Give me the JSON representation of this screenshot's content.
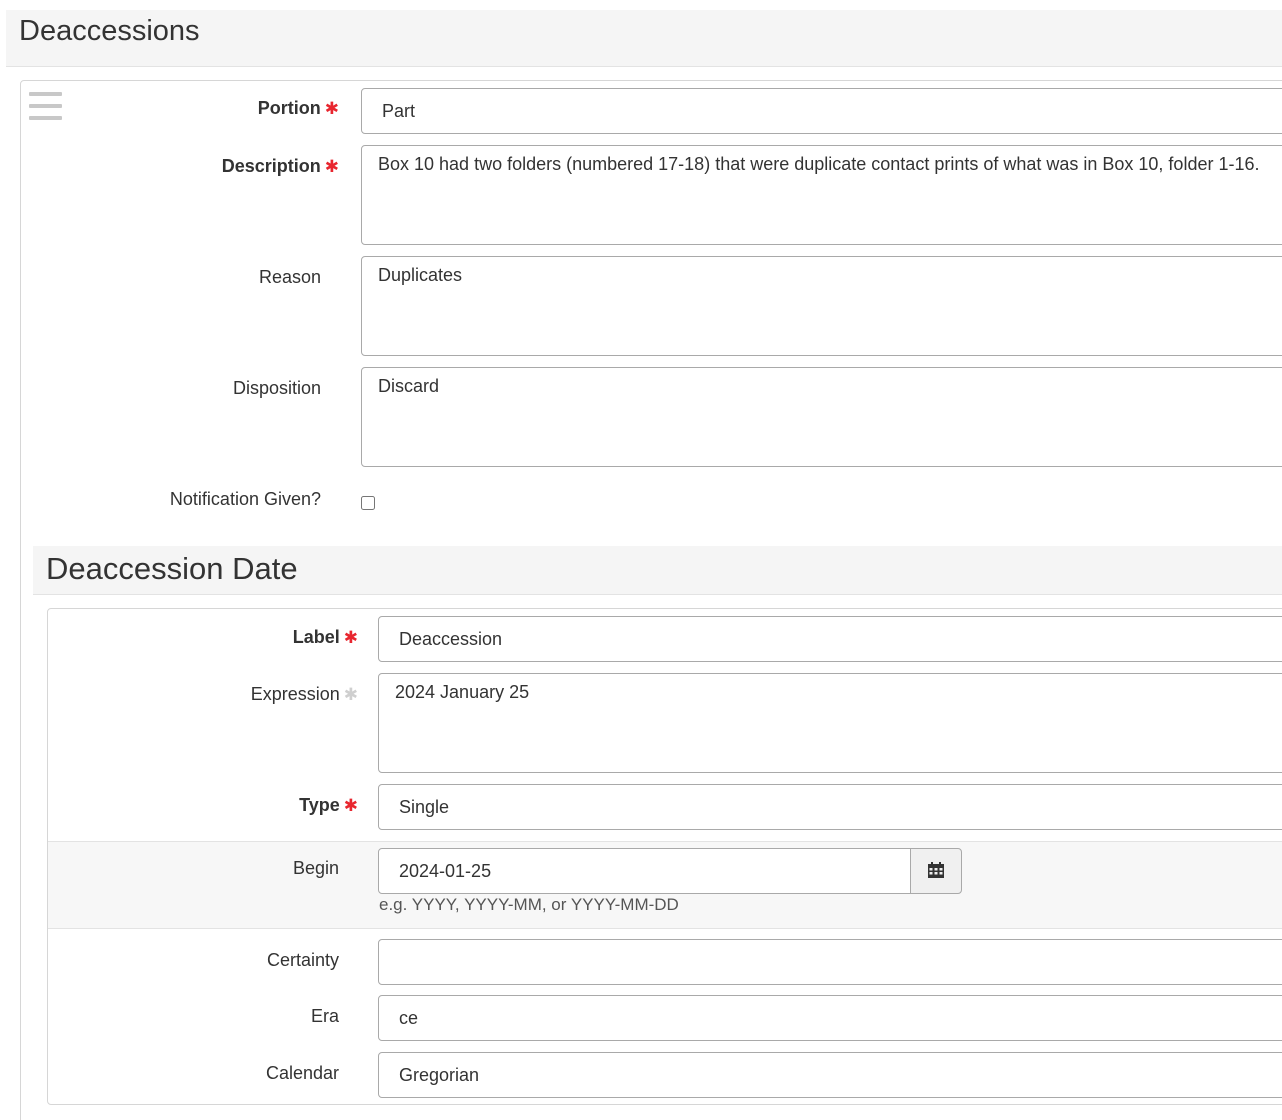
{
  "section": {
    "title": "Deaccessions"
  },
  "deaccession": {
    "portion": {
      "label": "Portion",
      "value": "Part"
    },
    "description": {
      "label": "Description",
      "value": "Box 10 had two folders (numbered 17-18) that were duplicate contact prints of what was in Box 10, folder 1-16."
    },
    "reason": {
      "label": "Reason",
      "value": "Duplicates"
    },
    "disposition": {
      "label": "Disposition",
      "value": "Discard"
    },
    "notification": {
      "label": "Notification Given?",
      "checked": false
    }
  },
  "date": {
    "title": "Deaccession Date",
    "label": {
      "label": "Label",
      "value": "Deaccession"
    },
    "expression": {
      "label": "Expression",
      "value": "2024 January 25"
    },
    "type": {
      "label": "Type",
      "value": "Single"
    },
    "begin": {
      "label": "Begin",
      "value": "2024-01-25",
      "hint": "e.g. YYYY, YYYY-MM, or YYYY-MM-DD",
      "icon": "calendar-icon"
    },
    "certainty": {
      "label": "Certainty",
      "value": ""
    },
    "era": {
      "label": "Era",
      "value": "ce"
    },
    "calendar": {
      "label": "Calendar",
      "value": "Gregorian"
    }
  },
  "required_marker": "✱",
  "colors": {
    "required": "#e8262f",
    "panel": "#f5f5f5",
    "border": "#a9a9a9"
  }
}
